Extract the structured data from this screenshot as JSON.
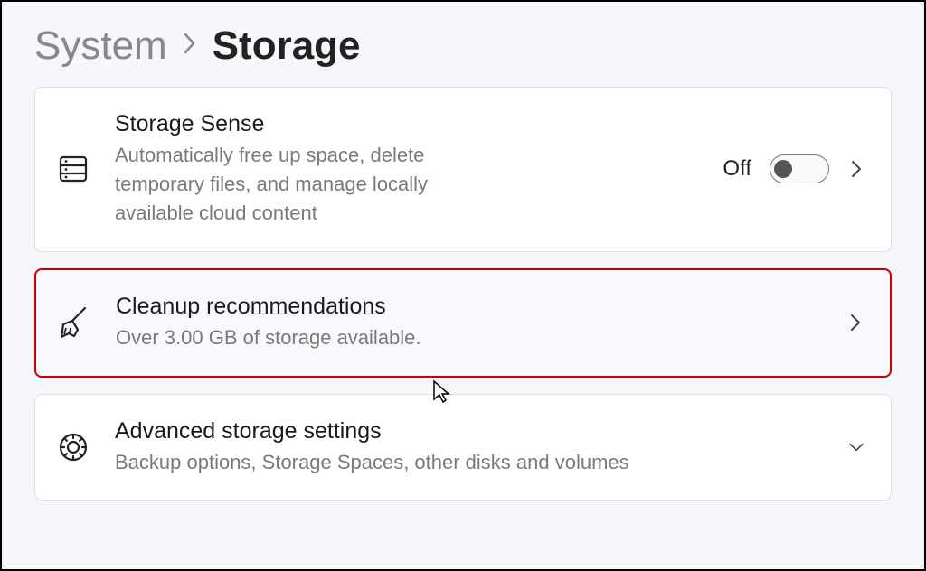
{
  "breadcrumb": {
    "parent": "System",
    "current": "Storage"
  },
  "cards": {
    "storage_sense": {
      "title": "Storage Sense",
      "desc": "Automatically free up space, delete temporary files, and manage locally available cloud content",
      "toggle_state": "Off"
    },
    "cleanup": {
      "title": "Cleanup recommendations",
      "desc": "Over 3.00 GB of storage available."
    },
    "advanced": {
      "title": "Advanced storage settings",
      "desc": "Backup options, Storage Spaces, other disks and volumes"
    }
  }
}
